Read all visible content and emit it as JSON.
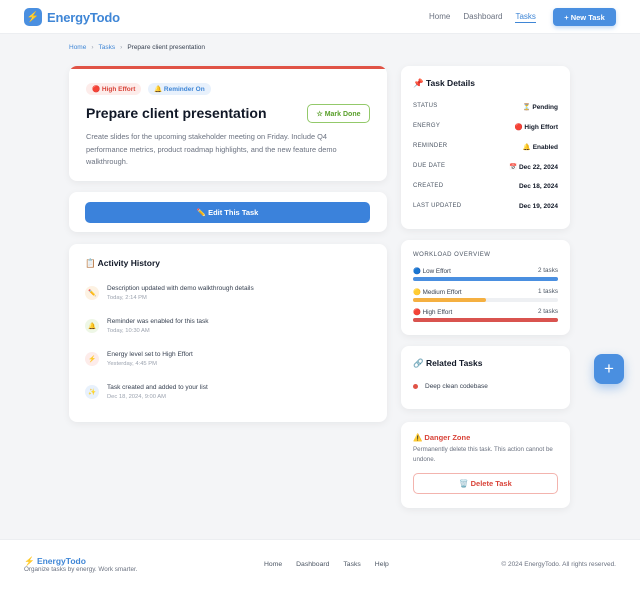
{
  "header": {
    "logo_icon": "⚡",
    "brand": "EnergyTodo",
    "nav": [
      {
        "label": "Home",
        "active": false
      },
      {
        "label": "Dashboard",
        "active": false
      },
      {
        "label": "Tasks",
        "active": true
      }
    ],
    "new_task_label": "+ New Task"
  },
  "breadcrumb": [
    "Home",
    "Tasks",
    "Prepare client presentation"
  ],
  "task": {
    "badge_effort": "🔴 High Effort",
    "badge_reminder": "🔔 Reminder On",
    "title": "Prepare client presentation",
    "mark_done_label": "☆ Mark Done",
    "description": "Create slides for the upcoming stakeholder meeting on Friday. Include Q4 performance metrics, product roadmap highlights, and the new feature demo walkthrough."
  },
  "edit_label": "✏️ Edit This Task",
  "activity": {
    "title": "📋 Activity History",
    "items": [
      {
        "icon": "✏️",
        "text": "Description updated with demo walkthrough details",
        "time": "Today, 2:14 PM"
      },
      {
        "icon": "🔔",
        "text": "Reminder was enabled for this task",
        "time": "Today, 10:30 AM"
      },
      {
        "icon": "⚡",
        "text": "Energy level set to High Effort",
        "time": "Yesterday, 4:45 PM"
      },
      {
        "icon": "✨",
        "text": "Task created and added to your list",
        "time": "Dec 18, 2024, 9:00 AM"
      }
    ]
  },
  "details": {
    "title": "📌 Task Details",
    "rows": [
      {
        "label": "STATUS",
        "value": "⏳ Pending"
      },
      {
        "label": "ENERGY",
        "value": "🔴 High Effort"
      },
      {
        "label": "REMINDER",
        "value": "🔔 Enabled"
      },
      {
        "label": "DUE DATE",
        "value": "📅 Dec 22, 2024"
      },
      {
        "label": "CREATED",
        "value": "Dec 18, 2024"
      },
      {
        "label": "LAST UPDATED",
        "value": "Dec 19, 2024"
      }
    ]
  },
  "workload": {
    "title": "WORKLOAD OVERVIEW",
    "items": [
      {
        "label": "🔵 Low Effort",
        "count": "2 tasks",
        "fraction": 1.0,
        "color": "#4a8fe0"
      },
      {
        "label": "🟡 Medium Effort",
        "count": "1 tasks",
        "fraction": 0.5,
        "color": "#f5b041"
      },
      {
        "label": "🔴 High Effort",
        "count": "2 tasks",
        "fraction": 1.0,
        "color": "#d9534f"
      }
    ]
  },
  "related": {
    "title": "🔗 Related Tasks",
    "items": [
      "Deep clean codebase"
    ]
  },
  "danger": {
    "title": "⚠️ Danger Zone",
    "description": "Permanently delete this task. This action cannot be undone.",
    "delete_label": "🗑️ Delete Task"
  },
  "fab_label": "+",
  "footer": {
    "brand": "⚡ EnergyTodo",
    "tagline": "Organize tasks by energy. Work smarter.",
    "nav": [
      "Home",
      "Dashboard",
      "Tasks",
      "Help"
    ],
    "copyright": "© 2024 EnergyTodo. All rights reserved."
  },
  "colors": {
    "accent": "#4a8fe0",
    "danger": "#d9443a",
    "success": "#5aa02c"
  }
}
